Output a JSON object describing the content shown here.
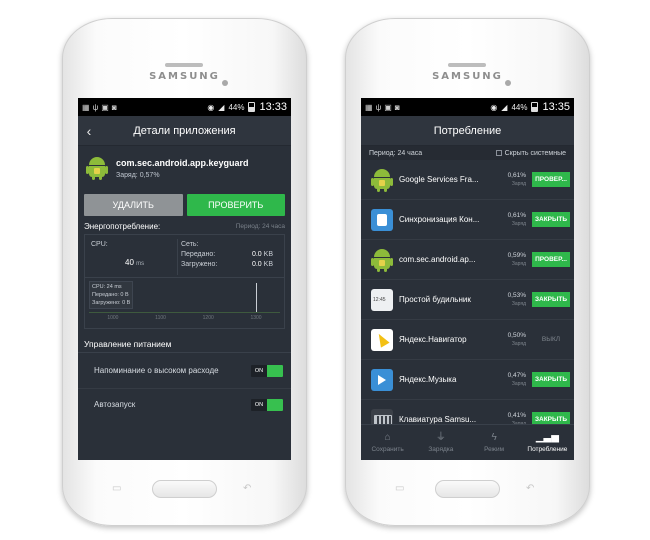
{
  "device": {
    "brand": "SAMSUNG"
  },
  "left": {
    "status": {
      "time": "13:33",
      "battery": "44%"
    },
    "header": {
      "back_icon": "chevron-left-icon",
      "title": "Детали приложения"
    },
    "app": {
      "package": "com.sec.android.app.keyguard",
      "charge": "Заряд: 0,57%"
    },
    "buttons": {
      "delete": "УДАЛИТЬ",
      "check": "ПРОВЕРИТЬ"
    },
    "energy": {
      "title": "Энергопотребление:",
      "period": "Период: 24 часа",
      "cpu_label": "CPU:",
      "cpu_value": "40",
      "cpu_unit": "ms",
      "net_label": "Сеть:",
      "sent_label": "Передано:",
      "sent_value": "0.0",
      "sent_unit": "KB",
      "recv_label": "Загружено:",
      "recv_value": "0.0",
      "recv_unit": "KB",
      "tooltip": {
        "cpu": "CPU: 24 ms",
        "sent": "Передано: 0 B",
        "recv": "Загружено: 0 B"
      },
      "ticks": [
        "1000",
        "1100",
        "1200",
        "1300"
      ]
    },
    "power": {
      "title": "Управление питанием",
      "high_usage_label": "Напоминание о высоком расходе",
      "high_usage_state": "ON",
      "autostart_label": "Автозапуск",
      "autostart_state": "ON"
    }
  },
  "right": {
    "status": {
      "time": "13:35",
      "battery": "44%"
    },
    "header": {
      "title": "Потребление"
    },
    "subbar": {
      "period": "Период: 24 часа",
      "hide_system": "Скрыть системные"
    },
    "apps": [
      {
        "name": "Google Services Fra...",
        "pct": "0,61%",
        "sub": "Заряд",
        "action": "ПРОВЕР...",
        "icon": "android-icon"
      },
      {
        "name": "Синхронизация Кон...",
        "pct": "0,61%",
        "sub": "Заряд",
        "action": "ЗАКРЫТЬ",
        "icon": "contacts-sync-icon"
      },
      {
        "name": "com.sec.android.ap...",
        "pct": "0,59%",
        "sub": "Заряд",
        "action": "ПРОВЕР...",
        "icon": "android-icon"
      },
      {
        "name": "Простой будильник",
        "pct": "0,53%",
        "sub": "Заряд",
        "action": "ЗАКРЫТЬ",
        "icon": "alarm-clock-icon"
      },
      {
        "name": "Яндекс.Навигатор",
        "pct": "0,50%",
        "sub": "Заряд",
        "action": "ВЫКЛ",
        "icon": "navigator-icon"
      },
      {
        "name": "Яндекс.Музыка",
        "pct": "0,47%",
        "sub": "Заряд",
        "action": "ЗАКРЫТЬ",
        "icon": "music-icon"
      },
      {
        "name": "Клавиатура Samsu...",
        "pct": "0,41%",
        "sub": "Заряд",
        "action": "ЗАКРЫТЬ",
        "icon": "keyboard-icon"
      }
    ],
    "nav": [
      {
        "label": "Сохранить",
        "icon": "home-icon"
      },
      {
        "label": "Зарядка",
        "icon": "plug-icon"
      },
      {
        "label": "Режим",
        "icon": "bolt-icon"
      },
      {
        "label": "Потребление",
        "icon": "bar-chart-icon"
      }
    ]
  },
  "colors": {
    "accent_green": "#2fb84b",
    "screen_bg": "#2a3039",
    "toggle_knob": "#37c04f"
  }
}
